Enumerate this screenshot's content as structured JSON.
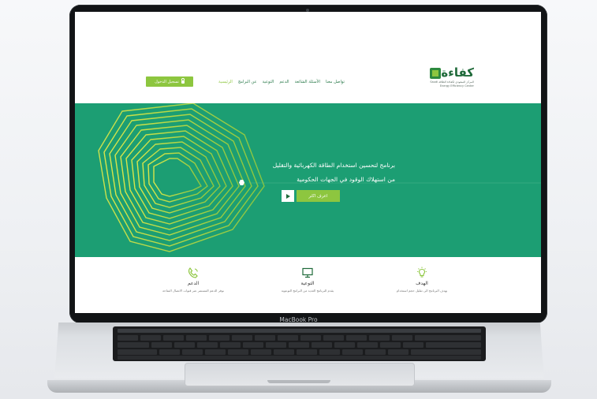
{
  "device": {
    "model_label": "MacBook Pro"
  },
  "site": {
    "logo": {
      "word": "كفاءة",
      "subtitle": "المركز السعودي لكفاءة الطاقة Saudi Energy Efficiency Center"
    },
    "nav": [
      {
        "label": "الرئيسية",
        "active": true
      },
      {
        "label": "عن البرامج",
        "active": false
      },
      {
        "label": "التوعية",
        "active": false
      },
      {
        "label": "الدعم",
        "active": false
      },
      {
        "label": "الأسئلة الشائعة",
        "active": false
      },
      {
        "label": "تواصل معنا",
        "active": false
      }
    ],
    "login_label": "تسجيل الدخول",
    "hero": {
      "line1": "برنامج لتحسين استخدام الطاقة الكهربائية والتقليل",
      "line2": "من استهلاك الوقود في الجهات الحكومية",
      "cta_label": "اعرف اكثر"
    },
    "features": [
      {
        "icon": "phone-icon",
        "title": "الدعم",
        "desc": "نوفر الدعم المستمر عبر قنوات الاتصال المتاحة"
      },
      {
        "icon": "monitor-icon",
        "title": "التوعية",
        "desc": "يقدم البرنامج العديد من البرامج التوعوية"
      },
      {
        "icon": "lightbulb-icon",
        "title": "الهدف",
        "desc": "يهدف البرنامج الى تقليل حجم استخدام"
      }
    ]
  },
  "colors": {
    "brand_green": "#1c9e73",
    "accent_lime": "#8dc63f",
    "dark_green": "#1f6a3a"
  }
}
